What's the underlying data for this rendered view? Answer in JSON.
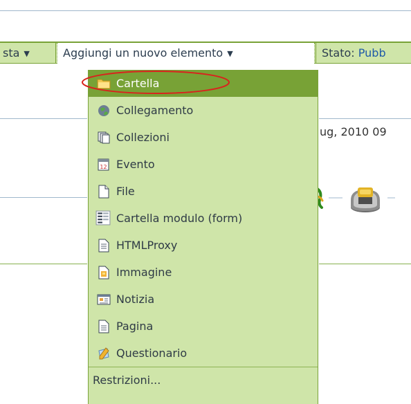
{
  "toolbar": {
    "left_partial_label": "sta",
    "add_new_label": "Aggiungi un nuovo elemento",
    "state_label": "Stato:",
    "state_value": "Pubb",
    "dropdown_arrow": "▼"
  },
  "background": {
    "date_fragment": "ug, 2010 09"
  },
  "menu": {
    "items": [
      {
        "label": "Cartella",
        "icon": "folder-icon",
        "selected": true
      },
      {
        "label": "Collegamento",
        "icon": "globe-link-icon",
        "selected": false
      },
      {
        "label": "Collezioni",
        "icon": "collection-icon",
        "selected": false
      },
      {
        "label": "Evento",
        "icon": "calendar-icon",
        "selected": false
      },
      {
        "label": "File",
        "icon": "file-icon",
        "selected": false
      },
      {
        "label": "Cartella modulo (form)",
        "icon": "form-folder-icon",
        "selected": false
      },
      {
        "label": "HTMLProxy",
        "icon": "html-proxy-icon",
        "selected": false
      },
      {
        "label": "Immagine",
        "icon": "image-icon",
        "selected": false
      },
      {
        "label": "Notizia",
        "icon": "news-icon",
        "selected": false
      },
      {
        "label": "Pagina",
        "icon": "page-icon",
        "selected": false
      },
      {
        "label": "Questionario",
        "icon": "questionnaire-icon",
        "selected": false
      }
    ],
    "restrictions_label": "Restrizioni..."
  },
  "colors": {
    "menu_bg": "#cfe5a9",
    "selected_bg": "#78a236",
    "highlight_ring": "#d9231d",
    "status_link": "#1e5aa8"
  }
}
